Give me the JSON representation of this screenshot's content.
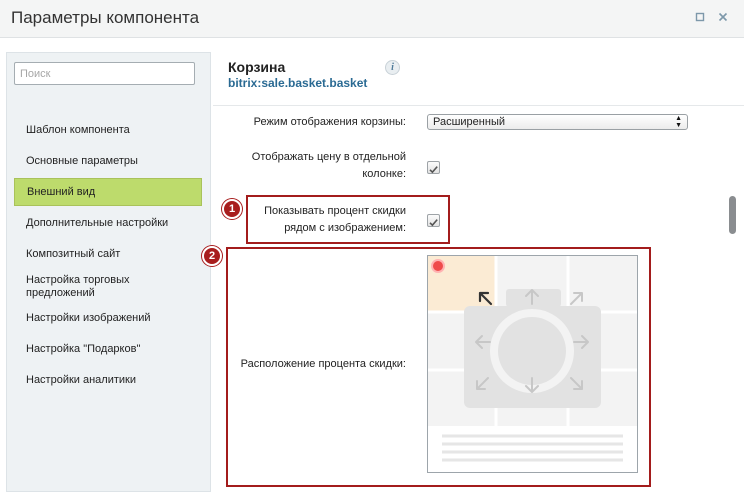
{
  "window": {
    "title": "Параметры компонента",
    "minimize_glyph": "▫",
    "close_glyph": "✕"
  },
  "sidebar": {
    "search_placeholder": "Поиск",
    "items": [
      {
        "label": "Шаблон компонента",
        "active": false
      },
      {
        "label": "Основные параметры",
        "active": false
      },
      {
        "label": "Внешний вид",
        "active": true
      },
      {
        "label": "Дополнительные настройки",
        "active": false
      },
      {
        "label": "Композитный сайт",
        "active": false
      },
      {
        "label": "Настройка торговых предложений",
        "active": false
      },
      {
        "label": "Настройки изображений",
        "active": false
      },
      {
        "label": "Настройка \"Подарков\"",
        "active": false
      },
      {
        "label": "Настройки аналитики",
        "active": false
      }
    ]
  },
  "component": {
    "title": "Корзина",
    "code": "bitrix:sale.basket.basket",
    "info_icon": "i"
  },
  "settings": {
    "mode_label": "Режим отображения корзины:",
    "mode_value": "Расширенный",
    "price_label_line1": "Отображать цену в отдельной",
    "price_label_line2": "колонке:",
    "price_checked": true,
    "discount_label_line1": "Показывать процент скидки",
    "discount_label_line2": "рядом с изображением:",
    "discount_checked": true,
    "position_label": "Расположение процента скидки:"
  },
  "annotations": [
    "1",
    "2"
  ],
  "colors": {
    "active_nav": "#bddb6c",
    "highlight": "#a31c1c",
    "selected_cell": "#fbebd4",
    "selected_marker": "#ef4b4b"
  }
}
